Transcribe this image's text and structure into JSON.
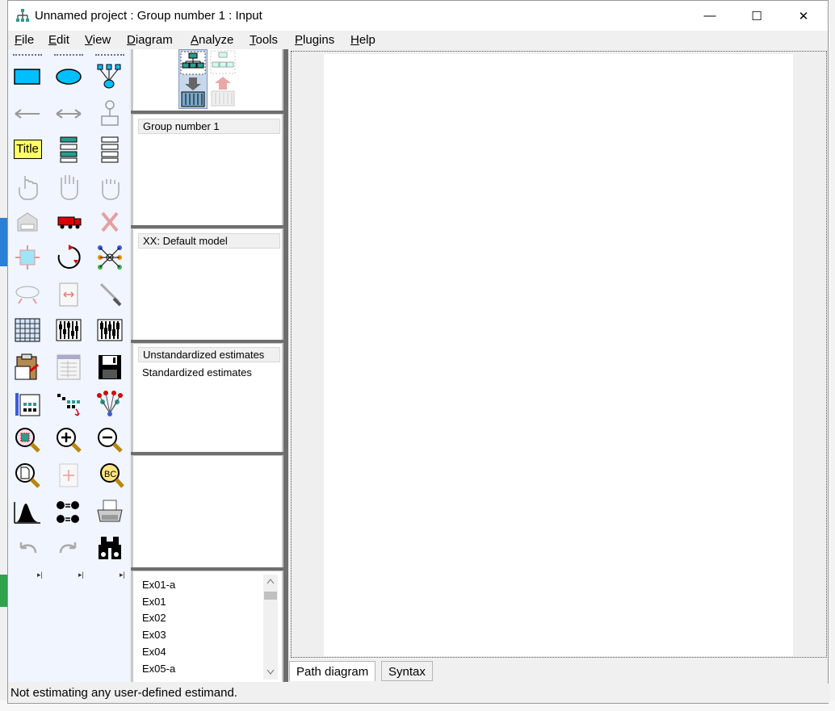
{
  "window": {
    "title": "Unnamed project : Group number 1 : Input",
    "minimize_glyph": "—",
    "maximize_glyph": "☐",
    "close_glyph": "✕"
  },
  "menu": {
    "file": {
      "u": "F",
      "rest": "ile"
    },
    "edit": {
      "u": "E",
      "rest": "dit"
    },
    "view": {
      "u": "V",
      "rest": "iew"
    },
    "diagram": {
      "u": "D",
      "rest": "iagram"
    },
    "analyze": {
      "u": "A",
      "rest": "nalyze"
    },
    "tools": {
      "u": "T",
      "rest": "ools"
    },
    "plugins": {
      "u": "P",
      "rest": "lugins"
    },
    "help": {
      "u": "H",
      "rest": "elp"
    }
  },
  "toolbox": {
    "title_tool_label": "Title",
    "more_glyph": "▸|"
  },
  "panels": {
    "groups": {
      "selected": "Group number 1"
    },
    "models": {
      "selected": "XX: Default model"
    },
    "estimates": {
      "selected": "Unstandardized estimates",
      "items": [
        "Standardized estimates"
      ]
    },
    "files": {
      "items": [
        "Ex01-a",
        "Ex01",
        "Ex02",
        "Ex03",
        "Ex04",
        "Ex05-a"
      ]
    }
  },
  "tabs": {
    "path_diagram": "Path diagram",
    "syntax": "Syntax"
  },
  "status": {
    "text": "Not estimating any user-defined estimand."
  },
  "icons": {
    "app": "amos-tree-icon",
    "accent_blue": "#00bfff",
    "accent_teal": "#2a9d8f"
  }
}
